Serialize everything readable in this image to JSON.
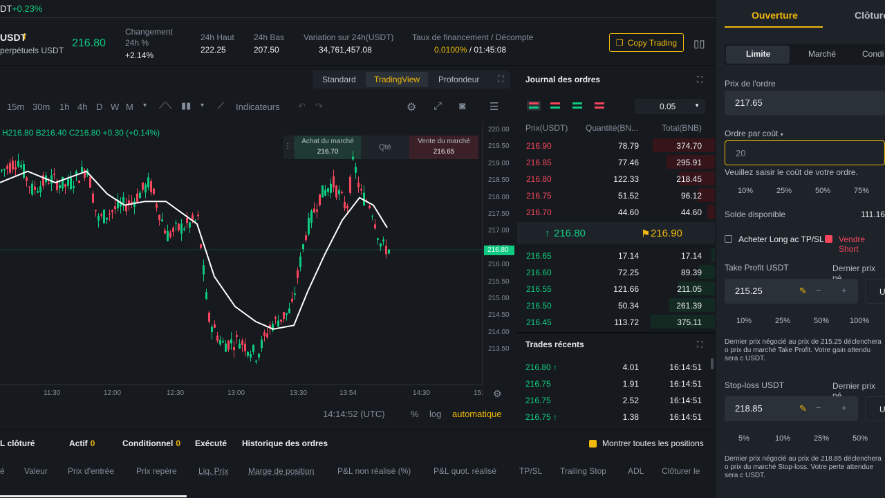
{
  "topstrip": {
    "pair_suffix": "DT",
    "change": "+0.23%"
  },
  "header": {
    "symbol": "USDT",
    "symbol_sub": "perpétuels USDT",
    "price": "216.80",
    "change_label": "Changement",
    "change_label2": "24h %",
    "change_value": "+2.14%",
    "high_label": "24h Haut",
    "high_value": "222.25",
    "low_label": "24h Bas",
    "low_value": "207.50",
    "vol_label": "Variation sur 24h(USDT)",
    "vol_value": "34,761,457.08",
    "funding_label": "Taux de financement / Décompte",
    "funding_rate": "0.0100%",
    "funding_countdown": "/ 01:45:08",
    "copy_trading": "Copy Trading"
  },
  "chart": {
    "view_tabs": [
      "Standard",
      "TradingView",
      "Profondeur"
    ],
    "active_view": "TradingView",
    "intervals": [
      "15m",
      "30m",
      "1h",
      "4h",
      "D",
      "W",
      "M"
    ],
    "indicators_label": "Indicateurs",
    "ohlc": "H216.80  B216.40  C216.80  +0.30 (+0.14%)",
    "buy_market_label": "Achat du marché",
    "buy_market_price": "216.70",
    "qty_label": "Qté",
    "sell_market_label": "Vente du marché",
    "sell_market_price": "216.65",
    "price_axis": [
      "220.00",
      "219.50",
      "219.00",
      "218.50",
      "218.00",
      "217.50",
      "217.00",
      "216.50",
      "216.00",
      "215.50",
      "215.00",
      "214.50",
      "214.00",
      "213.50"
    ],
    "current_price_tag": "216.80",
    "time_axis": [
      "11:30",
      "12:00",
      "12:30",
      "13:00",
      "13:30",
      "13:54",
      "14:30",
      "15:"
    ],
    "clock": "14:14:52 (UTC)",
    "pct_label": "%",
    "log_label": "log",
    "auto_label": "automatique"
  },
  "orderbook": {
    "title": "Journal des ordres",
    "tick": "0.05",
    "col_price": "Prix(USDT)",
    "col_qty": "Quantité(BN...",
    "col_total": "Total(BNB)",
    "asks": [
      {
        "price": "216.90",
        "qty": "78.79",
        "total": "374.70",
        "depth": 0.95
      },
      {
        "price": "216.85",
        "qty": "77.46",
        "total": "295.91",
        "depth": 0.74
      },
      {
        "price": "216.80",
        "qty": "122.33",
        "total": "218.45",
        "depth": 0.55
      },
      {
        "price": "216.75",
        "qty": "51.52",
        "total": "96.12",
        "depth": 0.26
      },
      {
        "price": "216.70",
        "qty": "44.60",
        "total": "44.60",
        "depth": 0.12
      }
    ],
    "mid_price": "216.80",
    "mark_price": "216.90",
    "bids": [
      {
        "price": "216.65",
        "qty": "17.14",
        "total": "17.14",
        "depth": 0.05
      },
      {
        "price": "216.60",
        "qty": "72.25",
        "total": "89.39",
        "depth": 0.24
      },
      {
        "price": "216.55",
        "qty": "121.66",
        "total": "211.05",
        "depth": 0.56
      },
      {
        "price": "216.50",
        "qty": "50.34",
        "total": "261.39",
        "depth": 0.69
      },
      {
        "price": "216.45",
        "qty": "113.72",
        "total": "375.11",
        "depth": 0.98
      }
    ]
  },
  "trades": {
    "title": "Trades récents",
    "rows": [
      {
        "price": "216.80",
        "arrow": "↑",
        "qty": "4.01",
        "time": "16:14:51"
      },
      {
        "price": "216.75",
        "arrow": "",
        "qty": "1.91",
        "time": "16:14:51"
      },
      {
        "price": "216.75",
        "arrow": "",
        "qty": "2.52",
        "time": "16:14:51"
      },
      {
        "price": "216.75",
        "arrow": "↑",
        "qty": "1.38",
        "time": "16:14:51"
      }
    ]
  },
  "bottom": {
    "tabs": [
      {
        "label": "L clôturé",
        "count": ""
      },
      {
        "label": "Actif",
        "count": "0"
      },
      {
        "label": "Conditionnel",
        "count": "0"
      },
      {
        "label": "Exécuté",
        "count": ""
      },
      {
        "label": "Historique des ordres",
        "count": ""
      }
    ],
    "show_all": "Montrer toutes les positions",
    "columns": [
      "é",
      "Valeur",
      "Prix d'entrée",
      "Prix repère",
      "Liq. Prix",
      "Marge de position",
      "P&L non réalisé (%)",
      "P&L quot. réalisé",
      "TP/SL",
      "Trailing Stop",
      "ADL",
      "Clôturer le"
    ]
  },
  "order_panel": {
    "tab_open": "Ouverture",
    "tab_close": "Clôture",
    "types": [
      "Limite",
      "Marché",
      "Condi"
    ],
    "price_label": "Prix de l'ordre",
    "price_value": "217.65",
    "cost_label": "Ordre par coût",
    "cost_value": "20",
    "cost_hint": "Veuillez saisir le coût de votre ordre.",
    "cost_pcts": [
      "10%",
      "25%",
      "50%",
      "75%"
    ],
    "balance_label": "Solde disponible",
    "balance_value": "111.16",
    "long_label": "Acheter Long ac TP/SL",
    "short_label": "Vendre Short",
    "tp_label": "Take Profit  USDT",
    "tp_last_label": "Dernier prix né",
    "tp_value": "215.25",
    "tp_pcts": [
      "10%",
      "25%",
      "50%",
      "100%"
    ],
    "tp_hint": "Dernier prix négocié au prix de 215.25 déclenchera o prix du marché Take Profit. Votre gain attendu sera c USDT.",
    "sl_label": "Stop-loss  USDT",
    "sl_last_label": "Dernier prix né",
    "sl_value": "218.85",
    "sl_pcts": [
      "5%",
      "10%",
      "25%",
      "50%"
    ],
    "sl_hint": "Dernier prix négocié au prix de 218.85 déclenchera o prix du marché Stop-loss. Votre perte attendue sera c USDT."
  },
  "colors": {
    "up": "#0ecb81",
    "down": "#f6465d",
    "accent": "#f0b90b",
    "bg": "#161a1e"
  }
}
